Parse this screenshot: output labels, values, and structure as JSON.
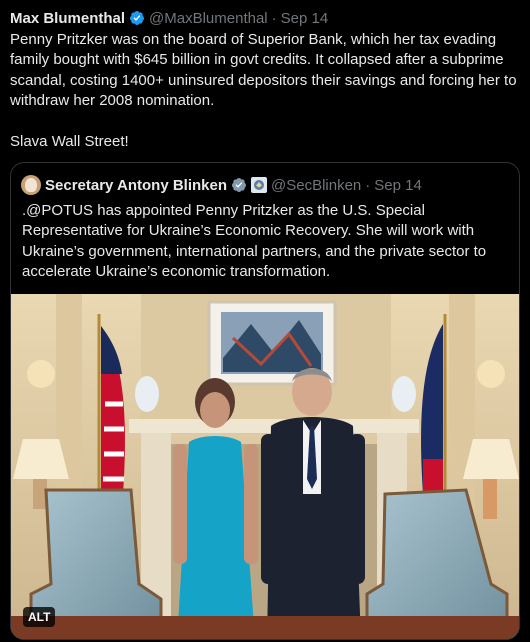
{
  "tweet": {
    "author_name": "Max Blumenthal",
    "author_handle": "@MaxBlumenthal",
    "separator": "·",
    "date": "Sep 14",
    "text_1": "Penny Pritzker was on the board of Superior Bank, which her tax evading family bought with $645 billion in govt credits. It collapsed after a subprime scandal, costing 1400+ uninsured depositors their savings and forcing her to withdraw her 2008 nomination.",
    "text_2": "Slava Wall Street!"
  },
  "quote": {
    "author_name": "Secretary Antony Blinken",
    "author_handle": "@SecBlinken",
    "separator": "·",
    "date": "Sep 14",
    "text": ".@POTUS has appointed Penny Pritzker as the U.S. Special Representative for Ukraine’s Economic Recovery. She will work with Ukraine’s government, international partners, and the private sector to accelerate Ukraine’s economic transformation.",
    "image_badge": "ALT"
  },
  "colors": {
    "background": "#000000",
    "text": "#e7e9ea",
    "muted": "#71767b",
    "verified": "#1d9bf0",
    "border": "#2f3336"
  },
  "icons": [
    "verified-badge-icon",
    "government-badge-icon",
    "avatar"
  ]
}
